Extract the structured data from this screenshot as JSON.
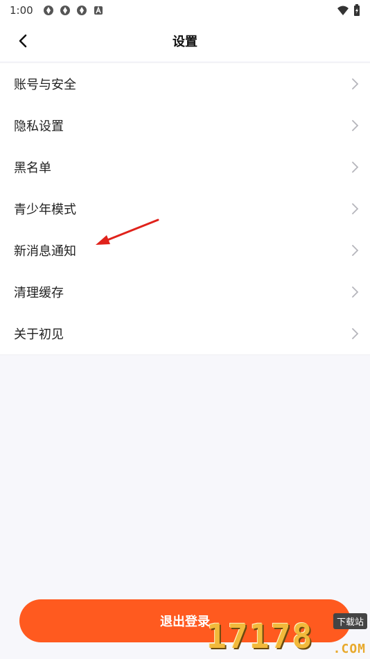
{
  "status_bar": {
    "time": "1:00",
    "icons": [
      "settings-app-icon",
      "settings-app-icon",
      "settings-app-icon",
      "a-icon"
    ],
    "right_icons": [
      "wifi-icon",
      "battery-charging-icon"
    ]
  },
  "header": {
    "title": "设置",
    "back_icon": "chevron-left-icon"
  },
  "menu": {
    "items": [
      {
        "label": "账号与安全"
      },
      {
        "label": "隐私设置"
      },
      {
        "label": "黑名单"
      },
      {
        "label": "青少年模式"
      },
      {
        "label": "新消息通知"
      },
      {
        "label": "清理缓存"
      },
      {
        "label": "关于初见"
      }
    ]
  },
  "logout": {
    "label": "退出登录"
  },
  "watermark": {
    "digits": "17178",
    "badge": "下载站",
    "domain": ".COM"
  },
  "colors": {
    "accent": "#ff5a1f",
    "annotation": "#e0221b",
    "background": "#f7f7fb"
  }
}
